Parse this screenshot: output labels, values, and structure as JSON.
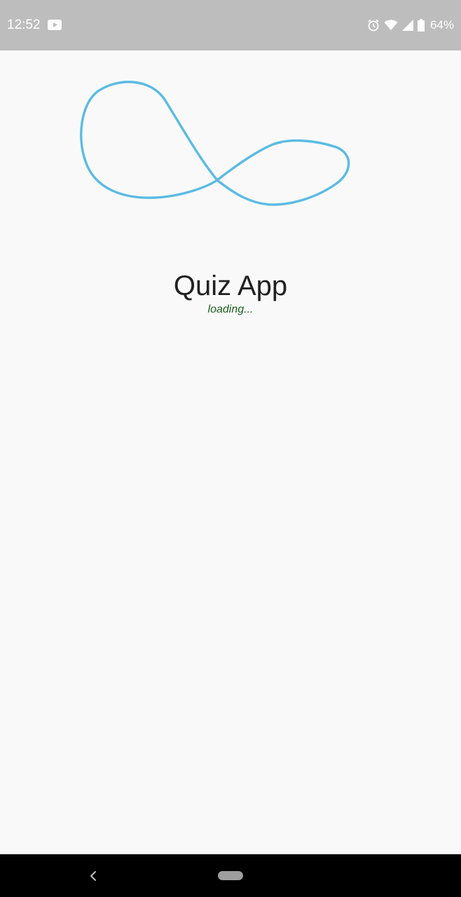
{
  "status_bar": {
    "time": "12:52",
    "battery_percent": "64%",
    "icons": [
      "youtube-icon",
      "alarm-icon",
      "wifi-icon",
      "signal-icon",
      "battery-icon"
    ]
  },
  "splash": {
    "logo_icon": "infinity-logo-icon",
    "title": "Quiz App",
    "subtitle": "loading..."
  },
  "nav_bar": {
    "icons": [
      "back-icon",
      "home-pill-icon"
    ]
  },
  "colors": {
    "background": "#f9f9f9",
    "status_bar": "#bdbdbd",
    "logo_stroke": "#5bbbe3",
    "title": "#212121",
    "loading": "#1b5e20",
    "nav_bar": "#000000"
  }
}
